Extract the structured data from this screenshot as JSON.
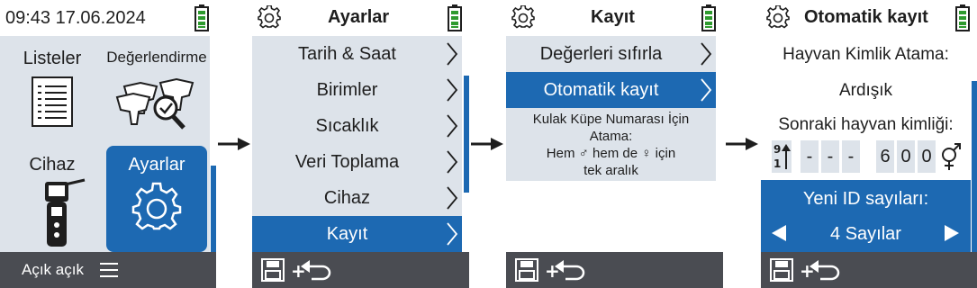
{
  "screen_home": {
    "clock": "09:43 17.06.2024",
    "tiles": [
      "Listeler",
      "Değerlendirme",
      "Cihaz",
      "Ayarlar"
    ],
    "footer_status": "Açık açık"
  },
  "screen_settings": {
    "title": "Ayarlar",
    "items": [
      "Tarih & Saat",
      "Birimler",
      "Sıcaklık",
      "Veri Toplama",
      "Cihaz",
      "Kayıt"
    ]
  },
  "screen_record": {
    "title": "Kayıt",
    "items": [
      "Değerleri sıfırla",
      "Otomatik kayıt"
    ],
    "info_lines": [
      "Kulak Küpe Numarası İçin",
      "Atama:",
      "Hem ♂ hem de ♀ için",
      "tek aralık"
    ]
  },
  "screen_auto": {
    "title": "Otomatik kayıt",
    "assign_label": "Hayvan Kimlik Atama:",
    "assign_value": "Ardışık",
    "next_id_label": "Sonraki hayvan kimliği:",
    "id_digits": [
      "-",
      "-",
      "-",
      "6",
      "0",
      "0"
    ],
    "new_id_label": "Yeni ID sayıları:",
    "new_id_value": "4 Sayılar"
  },
  "colors": {
    "accent": "#1d69b2",
    "panel": "#dde3ea",
    "footer": "#4a4c52",
    "battery": "#2e9a2e"
  },
  "icons": [
    "gear-icon",
    "battery-icon",
    "chevron-right-icon",
    "save-icon",
    "back-arrow-icon",
    "hamburger-icon",
    "list-document-icon",
    "evaluation-cows-icon",
    "device-reader-icon",
    "sort-icon",
    "gender-icon",
    "triangle-left-icon",
    "triangle-right-icon",
    "flow-arrow-icon"
  ]
}
